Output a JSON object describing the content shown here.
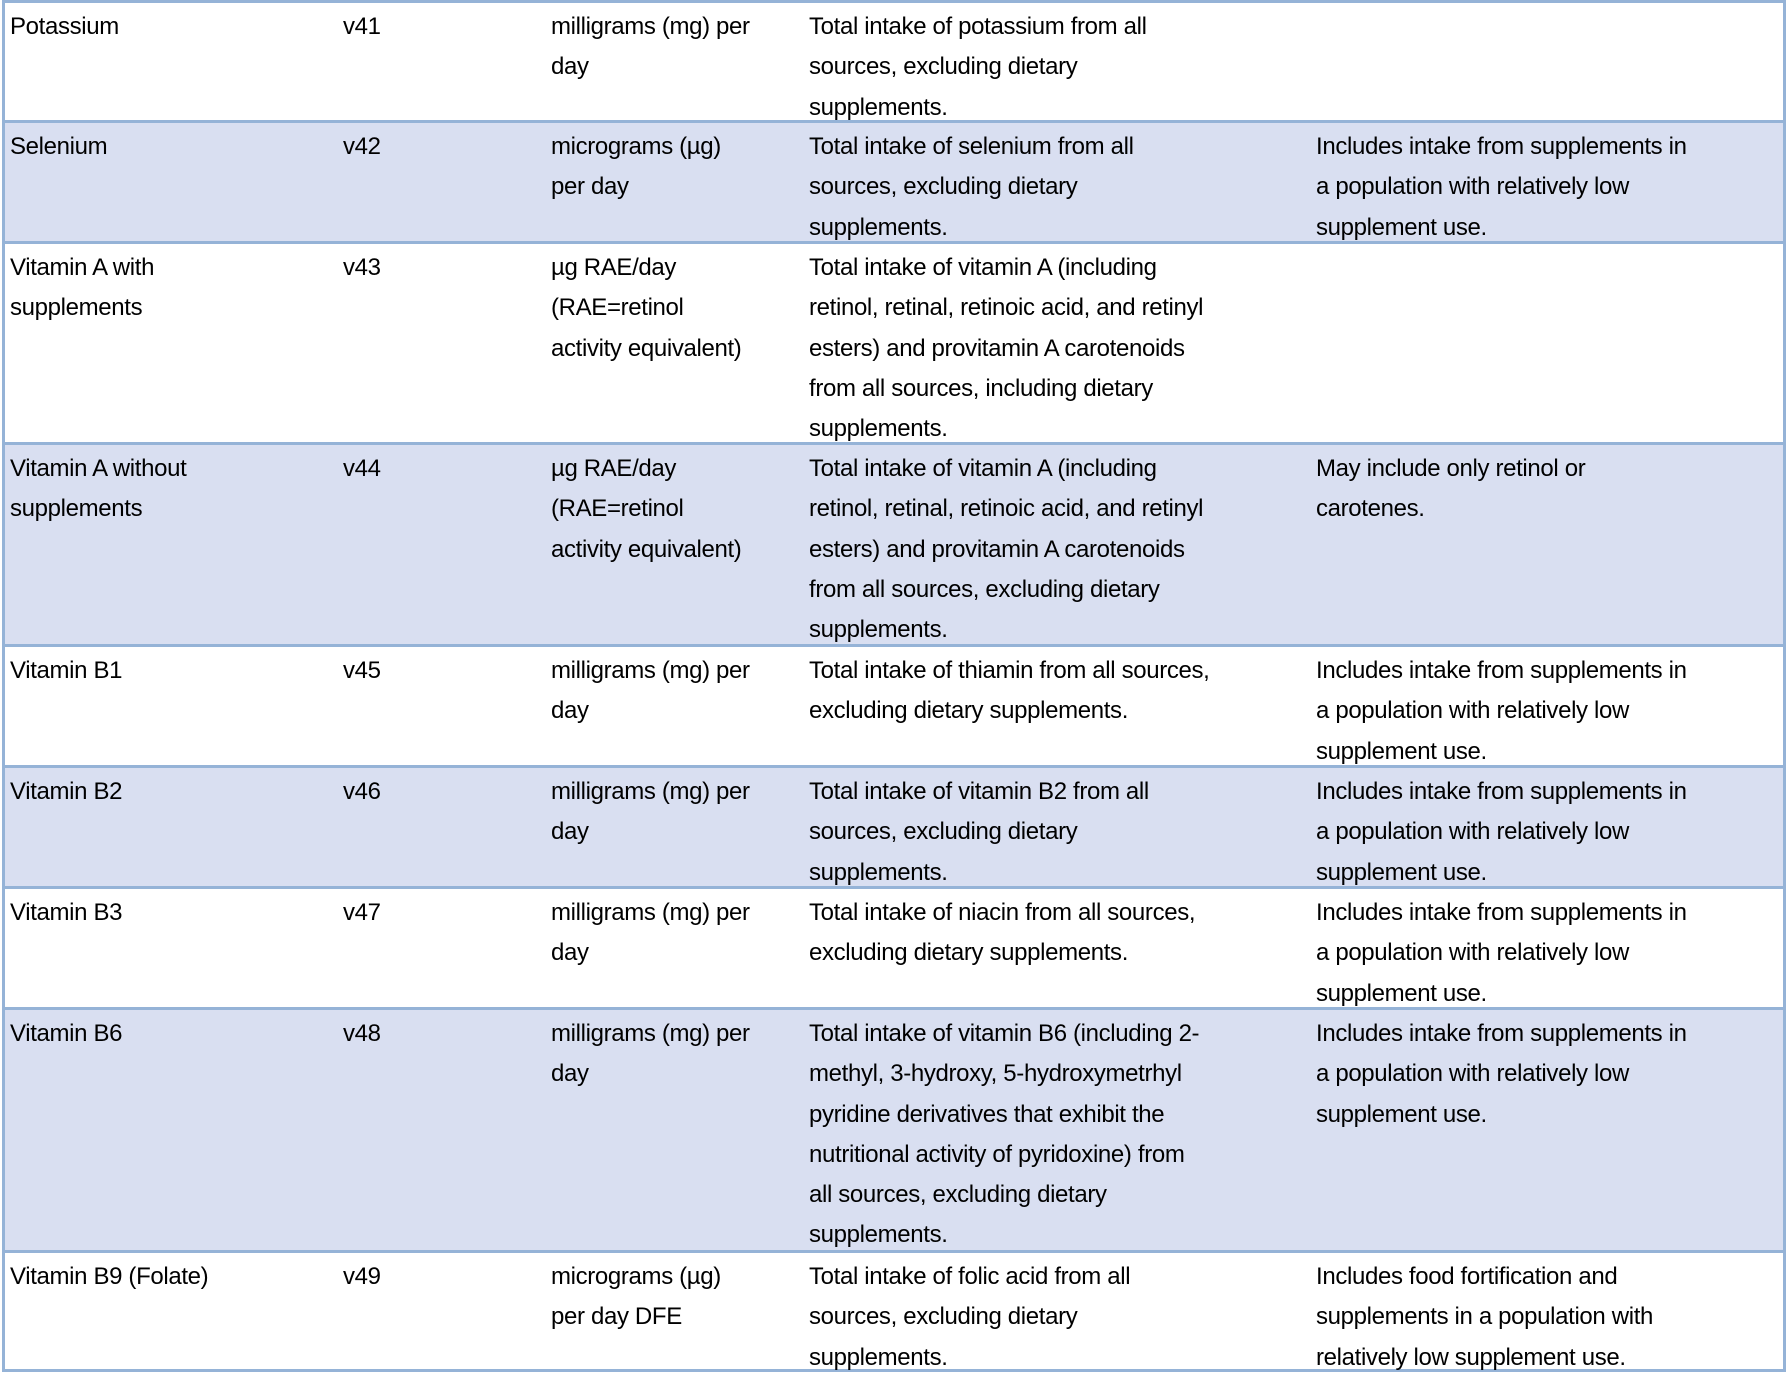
{
  "table": {
    "colors": {
      "border": "#95b3d7",
      "shaded_row": "#d9dff1",
      "plain_row": "#ffffff"
    },
    "rows": [
      {
        "nutrient": [
          "Potassium"
        ],
        "variable": [
          "v41"
        ],
        "unit": [
          "milligrams (mg) per",
          "day"
        ],
        "definition": [
          "Total intake of potassium from all",
          "sources, excluding dietary",
          "supplements."
        ],
        "notes": []
      },
      {
        "nutrient": [
          "Selenium"
        ],
        "variable": [
          "v42"
        ],
        "unit": [
          "micrograms (µg)",
          "per day"
        ],
        "definition": [
          "Total intake of selenium from all",
          "sources, excluding dietary",
          "supplements."
        ],
        "notes": [
          "Includes intake from supplements in",
          "a population with relatively low",
          "supplement use."
        ]
      },
      {
        "nutrient": [
          "Vitamin A with",
          "supplements"
        ],
        "variable": [
          "v43"
        ],
        "unit": [
          "µg RAE/day",
          "(RAE=retinol",
          "activity equivalent)"
        ],
        "definition": [
          "Total intake of vitamin A (including",
          "retinol, retinal, retinoic acid, and retinyl",
          "esters) and provitamin A carotenoids",
          "from all sources, including dietary",
          "supplements."
        ],
        "notes": []
      },
      {
        "nutrient": [
          "Vitamin A without",
          "supplements"
        ],
        "variable": [
          "v44"
        ],
        "unit": [
          "µg RAE/day",
          "(RAE=retinol",
          "activity equivalent)"
        ],
        "definition": [
          "Total intake of vitamin A (including",
          "retinol, retinal, retinoic acid, and retinyl",
          "esters) and provitamin A carotenoids",
          "from all sources, excluding dietary",
          "supplements."
        ],
        "notes": [
          "May include only retinol or",
          "carotenes."
        ]
      },
      {
        "nutrient": [
          "Vitamin B1"
        ],
        "variable": [
          "v45"
        ],
        "unit": [
          "milligrams (mg) per",
          "day"
        ],
        "definition": [
          "Total intake of thiamin from all sources,",
          "excluding dietary supplements."
        ],
        "notes": [
          "Includes intake from supplements in",
          "a population with relatively low",
          "supplement use."
        ]
      },
      {
        "nutrient": [
          "Vitamin B2"
        ],
        "variable": [
          "v46"
        ],
        "unit": [
          "milligrams (mg) per",
          "day"
        ],
        "definition": [
          "Total intake of vitamin B2 from all",
          "sources, excluding dietary",
          "supplements."
        ],
        "notes": [
          "Includes intake from supplements in",
          "a population with relatively low",
          "supplement use."
        ]
      },
      {
        "nutrient": [
          "Vitamin B3"
        ],
        "variable": [
          "v47"
        ],
        "unit": [
          "milligrams (mg) per",
          "day"
        ],
        "definition": [
          "Total intake of niacin from all sources,",
          "excluding dietary supplements."
        ],
        "notes": [
          "Includes intake from supplements in",
          "a population with relatively low",
          "supplement use."
        ]
      },
      {
        "nutrient": [
          "Vitamin B6"
        ],
        "variable": [
          "v48"
        ],
        "unit": [
          "milligrams (mg) per",
          "day"
        ],
        "definition": [
          "Total intake of vitamin B6 (including 2-",
          "methyl, 3-hydroxy, 5-hydroxymetrhyl",
          "pyridine derivatives that exhibit the",
          "nutritional activity of pyridoxine) from",
          "all sources, excluding dietary",
          "supplements."
        ],
        "notes": [
          "Includes intake from supplements in",
          "a population with relatively low",
          "supplement use."
        ]
      },
      {
        "nutrient": [
          "Vitamin B9 (Folate)"
        ],
        "variable": [
          "v49"
        ],
        "unit": [
          "micrograms (µg)",
          "per day DFE"
        ],
        "definition": [
          "Total intake of folic acid from all",
          "sources, excluding dietary",
          "supplements."
        ],
        "notes": [
          "Includes food fortification and",
          "supplements in a population with",
          "relatively low supplement use."
        ]
      }
    ]
  }
}
